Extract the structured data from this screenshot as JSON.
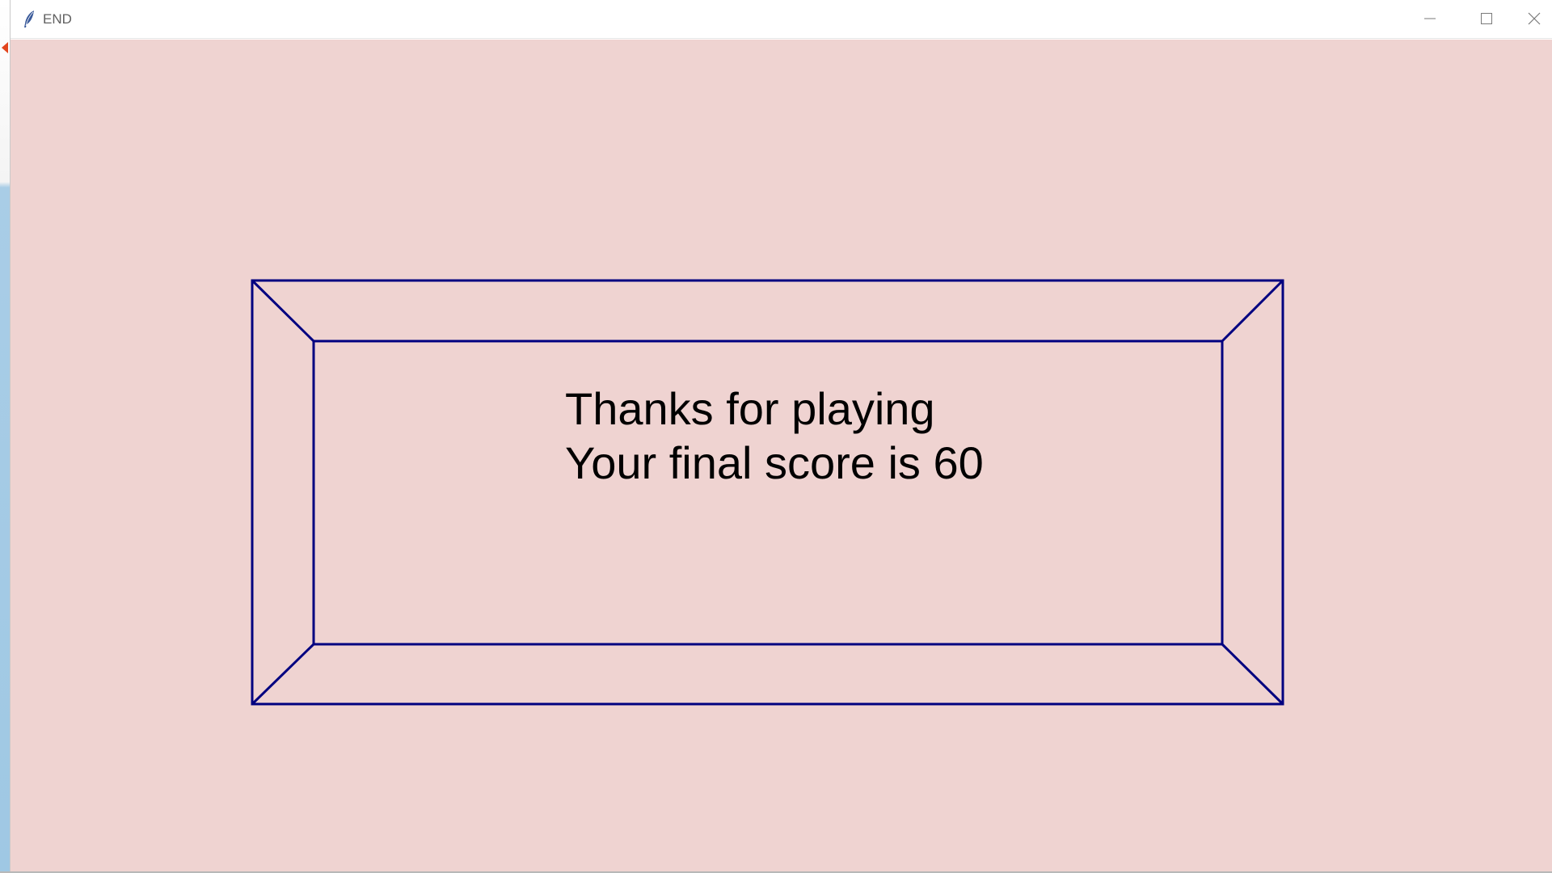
{
  "window": {
    "title": "END",
    "controls": {
      "minimize_icon": "minimize-icon",
      "maximize_icon": "maximize-icon",
      "close_icon": "close-icon"
    }
  },
  "game": {
    "background_color": "#efd3d1",
    "frame_color": "#000080",
    "message_line_1": "Thanks for playing",
    "message_line_2": "Your final score is 60"
  }
}
